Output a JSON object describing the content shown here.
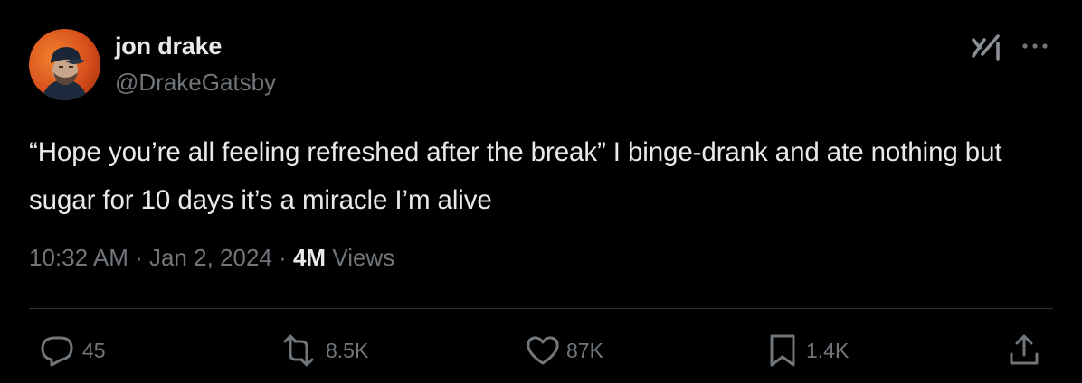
{
  "author": {
    "display_name": "jon drake",
    "handle": "@DrakeGatsby"
  },
  "tweet": {
    "text": "“Hope you’re all feeling refreshed after the break” I binge-drank and ate nothing but sugar for 10 days it’s a miracle I’m alive"
  },
  "meta": {
    "time": "10:32 AM",
    "separator": " · ",
    "date": "Jan 2, 2024",
    "views_count": "4M",
    "views_label": " Views"
  },
  "actions": {
    "replies": "45",
    "reposts": "8.5K",
    "likes": "87K",
    "bookmarks": "1.4K"
  },
  "icons": {
    "avatar": "avatar-photo",
    "grok": "grok-icon",
    "more": "more-options-icon",
    "reply": "reply-icon",
    "repost": "repost-icon",
    "like": "heart-icon",
    "bookmark": "bookmark-icon",
    "share": "share-icon"
  },
  "colors": {
    "background": "#000000",
    "primary_text": "#e7e9ea",
    "secondary_text": "#71767b",
    "divider": "#2f3336"
  }
}
